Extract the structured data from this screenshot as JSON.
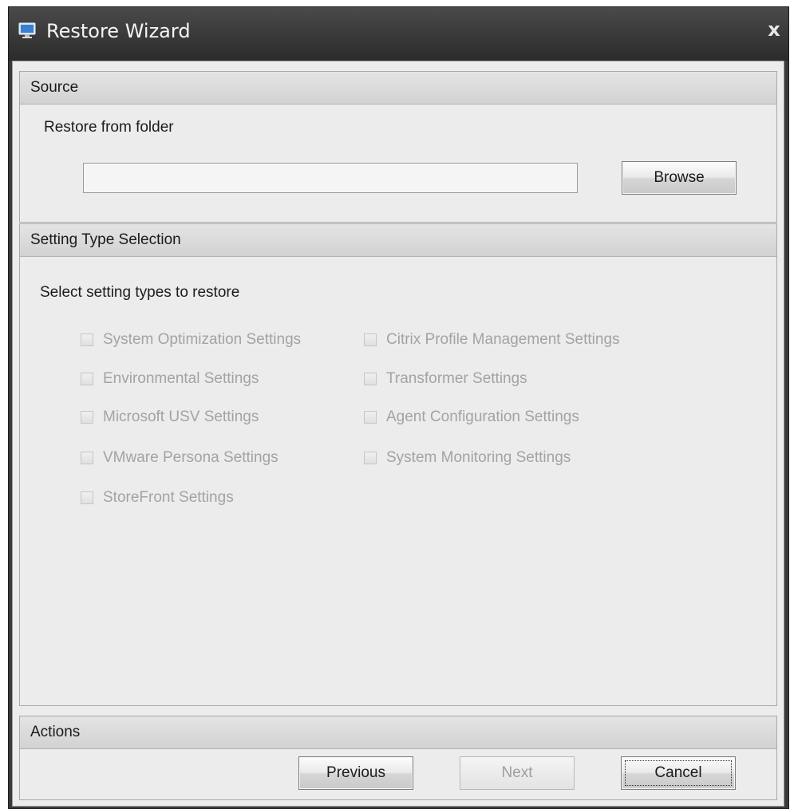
{
  "window": {
    "title": "Restore Wizard",
    "close_glyph": "x",
    "icon": "monitor-icon"
  },
  "source": {
    "header": "Source",
    "folder_label": "Restore from folder",
    "folder_value": "",
    "browse_label": "Browse"
  },
  "setting_types": {
    "header": "Setting Type Selection",
    "instruction": "Select setting types to restore",
    "items": [
      {
        "label": "System Optimization Settings",
        "checked": false,
        "enabled": false
      },
      {
        "label": "Environmental Settings",
        "checked": false,
        "enabled": false
      },
      {
        "label": "Microsoft USV Settings",
        "checked": false,
        "enabled": false
      },
      {
        "label": "VMware Persona Settings",
        "checked": false,
        "enabled": false
      },
      {
        "label": "StoreFront Settings",
        "checked": false,
        "enabled": false
      },
      {
        "label": "Citrix Profile Management Settings",
        "checked": false,
        "enabled": false
      },
      {
        "label": "Transformer Settings",
        "checked": false,
        "enabled": false
      },
      {
        "label": "Agent Configuration Settings",
        "checked": false,
        "enabled": false
      },
      {
        "label": "System Monitoring Settings",
        "checked": false,
        "enabled": false
      }
    ]
  },
  "actions": {
    "header": "Actions",
    "previous_label": "Previous",
    "next_label": "Next",
    "cancel_label": "Cancel"
  },
  "colors": {
    "title_bar": "#3a3a3a",
    "panel_bg": "#ececec",
    "disabled_text": "#a3a3a3"
  }
}
